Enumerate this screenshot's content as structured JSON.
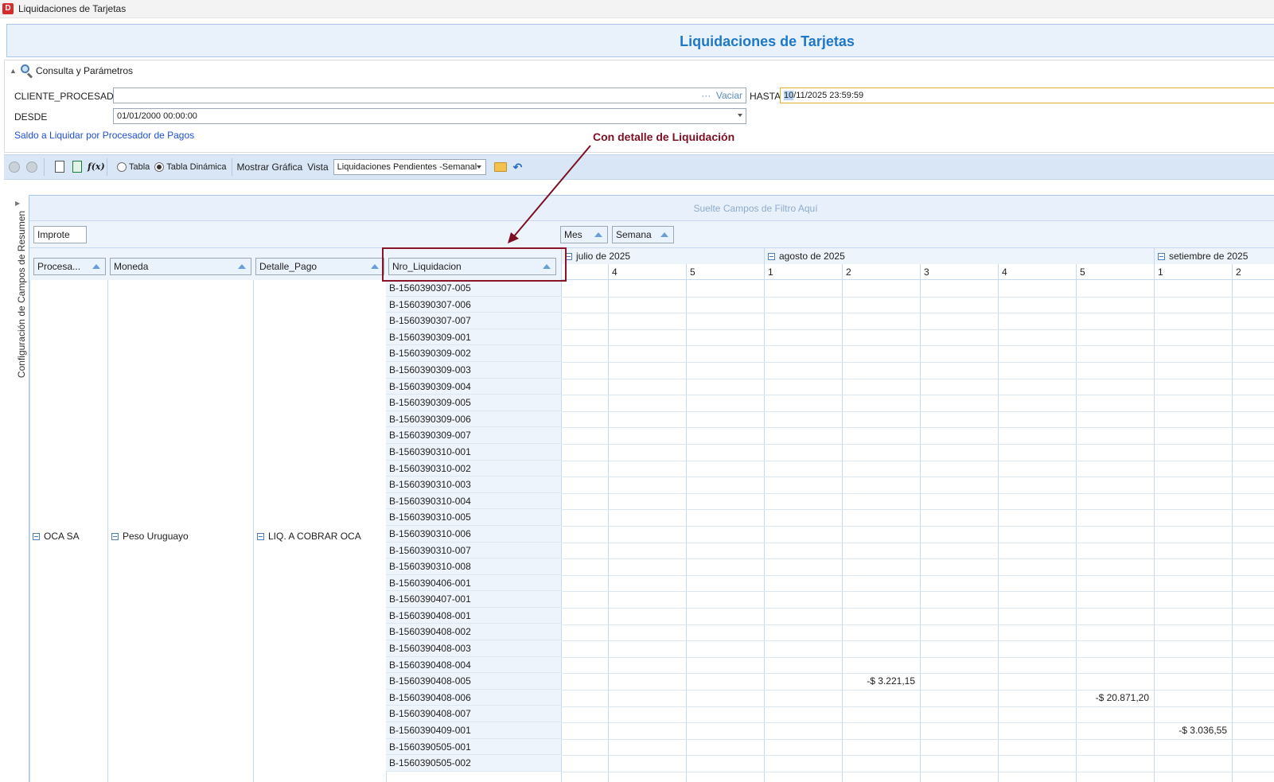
{
  "window": {
    "title": "Liquidaciones de Tarjetas",
    "icon": "app-icon"
  },
  "banner": {
    "title": "Liquidaciones de Tarjetas"
  },
  "params": {
    "section_label": "Consulta y Parámetros",
    "cliente_label": "CLIENTE_PROCESADOR",
    "cliente_value": "",
    "cliente_dots": "···",
    "cliente_clear": "Vaciar",
    "hasta_label": "HASTA",
    "hasta_value_selected": "10",
    "hasta_value_rest": "/11/2025 23:59:59",
    "desde_label": "DESDE",
    "desde_value": "01/01/2000 00:00:00",
    "link": "Saldo a Liquidar por Procesador de Pagos"
  },
  "callout": "Con detalle de Liquidación",
  "toolbar": {
    "radio_tabla": "Tabla",
    "radio_dinamica": "Tabla Dinámica",
    "mostrar_grafica": "Mostrar Gráfica",
    "vista_label": "Vista",
    "vista_value": "Liquidaciones Pendientes -Semanal",
    "selected_radio": "Tabla Dinámica"
  },
  "side_panel": {
    "label": "Configuración de Campos de Resumen"
  },
  "pivot": {
    "filter_hint": "Suelte Campos de Filtro Aquí",
    "data_field": "Improte",
    "column_fields": [
      "Mes",
      "Semana"
    ],
    "row_fields": [
      "Procesa...",
      "Moneda",
      "Detalle_Pago",
      "Nro_Liquidacion"
    ],
    "months": [
      "julio de 2025",
      "agosto de 2025",
      "setiembre de 2025"
    ],
    "weeks": [
      "",
      "4",
      "5",
      "1",
      "2",
      "3",
      "4",
      "5",
      "1",
      "2"
    ],
    "procesador": "OCA SA",
    "moneda": "Peso Uruguayo",
    "detalle_pago": "LIQ. A COBRAR OCA",
    "liquidaciones": [
      "B-1560390307-005",
      "B-1560390307-006",
      "B-1560390307-007",
      "B-1560390309-001",
      "B-1560390309-002",
      "B-1560390309-003",
      "B-1560390309-004",
      "B-1560390309-005",
      "B-1560390309-006",
      "B-1560390309-007",
      "B-1560390310-001",
      "B-1560390310-002",
      "B-1560390310-003",
      "B-1560390310-004",
      "B-1560390310-005",
      "B-1560390310-006",
      "B-1560390310-007",
      "B-1560390310-008",
      "B-1560390406-001",
      "B-1560390407-001",
      "B-1560390408-001",
      "B-1560390408-002",
      "B-1560390408-003",
      "B-1560390408-004",
      "B-1560390408-005",
      "B-1560390408-006",
      "B-1560390408-007",
      "B-1560390409-001",
      "B-1560390505-001",
      "B-1560390505-002"
    ],
    "values": [
      {
        "row": 24,
        "col": 4,
        "text": "-$ 3.221,15"
      },
      {
        "row": 25,
        "col": 7,
        "text": "-$ 20.871,20"
      },
      {
        "row": 27,
        "col": 8,
        "text": "-$ 3.036,55"
      }
    ]
  },
  "colors": {
    "accent": "#1e78c8",
    "callout": "#7c1022",
    "link": "#1f4fd6"
  }
}
